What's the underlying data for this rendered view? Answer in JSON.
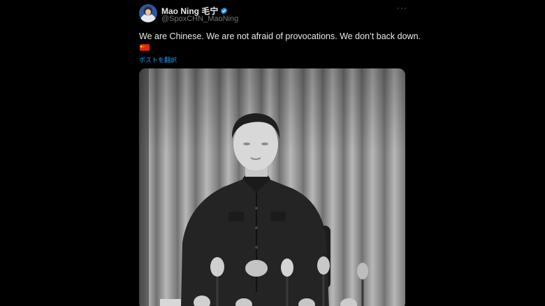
{
  "author": {
    "display_name": "Mao Ning 毛宁",
    "handle": "@SpoxCHN_MaoNing",
    "verified_icon": "verified-badge-icon",
    "avatar_icon": "avatar-portrait"
  },
  "tweet": {
    "text": "We are Chinese. We are not afraid of provocations. We don’t back down.",
    "emoji": "flag-cn-icon",
    "translate_label": "ポストを翻訳",
    "more_label": "···"
  },
  "media": {
    "type": "video-still",
    "description_icon": "black-and-white-photo"
  },
  "colors": {
    "background": "#000000",
    "text": "#e7e9ea",
    "secondary": "#71767b",
    "link": "#1d9bf0",
    "verified": "#1d9bf0"
  }
}
